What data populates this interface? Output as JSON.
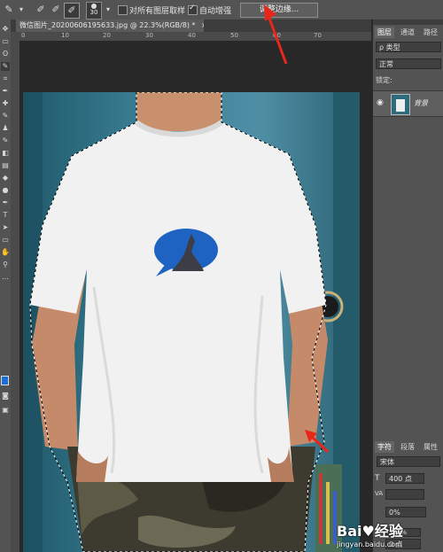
{
  "options_bar": {
    "brush_size": "30",
    "sample_all_layers_label": "对所有图层取样",
    "sample_all_layers_checked": false,
    "auto_enhance_label": "自动增强",
    "auto_enhance_checked": true,
    "refine_edge_label": "调整边缘..."
  },
  "document": {
    "tab_title": "微信图片_20200606195633.jpg @ 22.3%(RGB/8) *",
    "close_glyph": "×"
  },
  "ruler": {
    "ticks": [
      "0",
      "10",
      "20",
      "30",
      "40",
      "50",
      "60",
      "70"
    ]
  },
  "layers_panel": {
    "tabs": [
      "图层",
      "通道",
      "路径"
    ],
    "filter_label": "ρ 类型",
    "blend_mode": "正常",
    "lock_label": "锁定:",
    "layer_name": "背景",
    "icons": [
      "eye-icon"
    ]
  },
  "character_panel": {
    "tabs": [
      "字符",
      "段落",
      "属性"
    ],
    "font_family": "宋体",
    "font_size": "400 点",
    "tracking_label": "VA",
    "scale": "0%",
    "leading_small": "100%",
    "baseline": "0 点"
  },
  "watermark": "jingyan.baidu.com",
  "colors": {
    "panel": "#535353",
    "canvas_bg": "#282828",
    "annotation": "#e8271b",
    "foreground_swatch": "#1a6fd6"
  }
}
